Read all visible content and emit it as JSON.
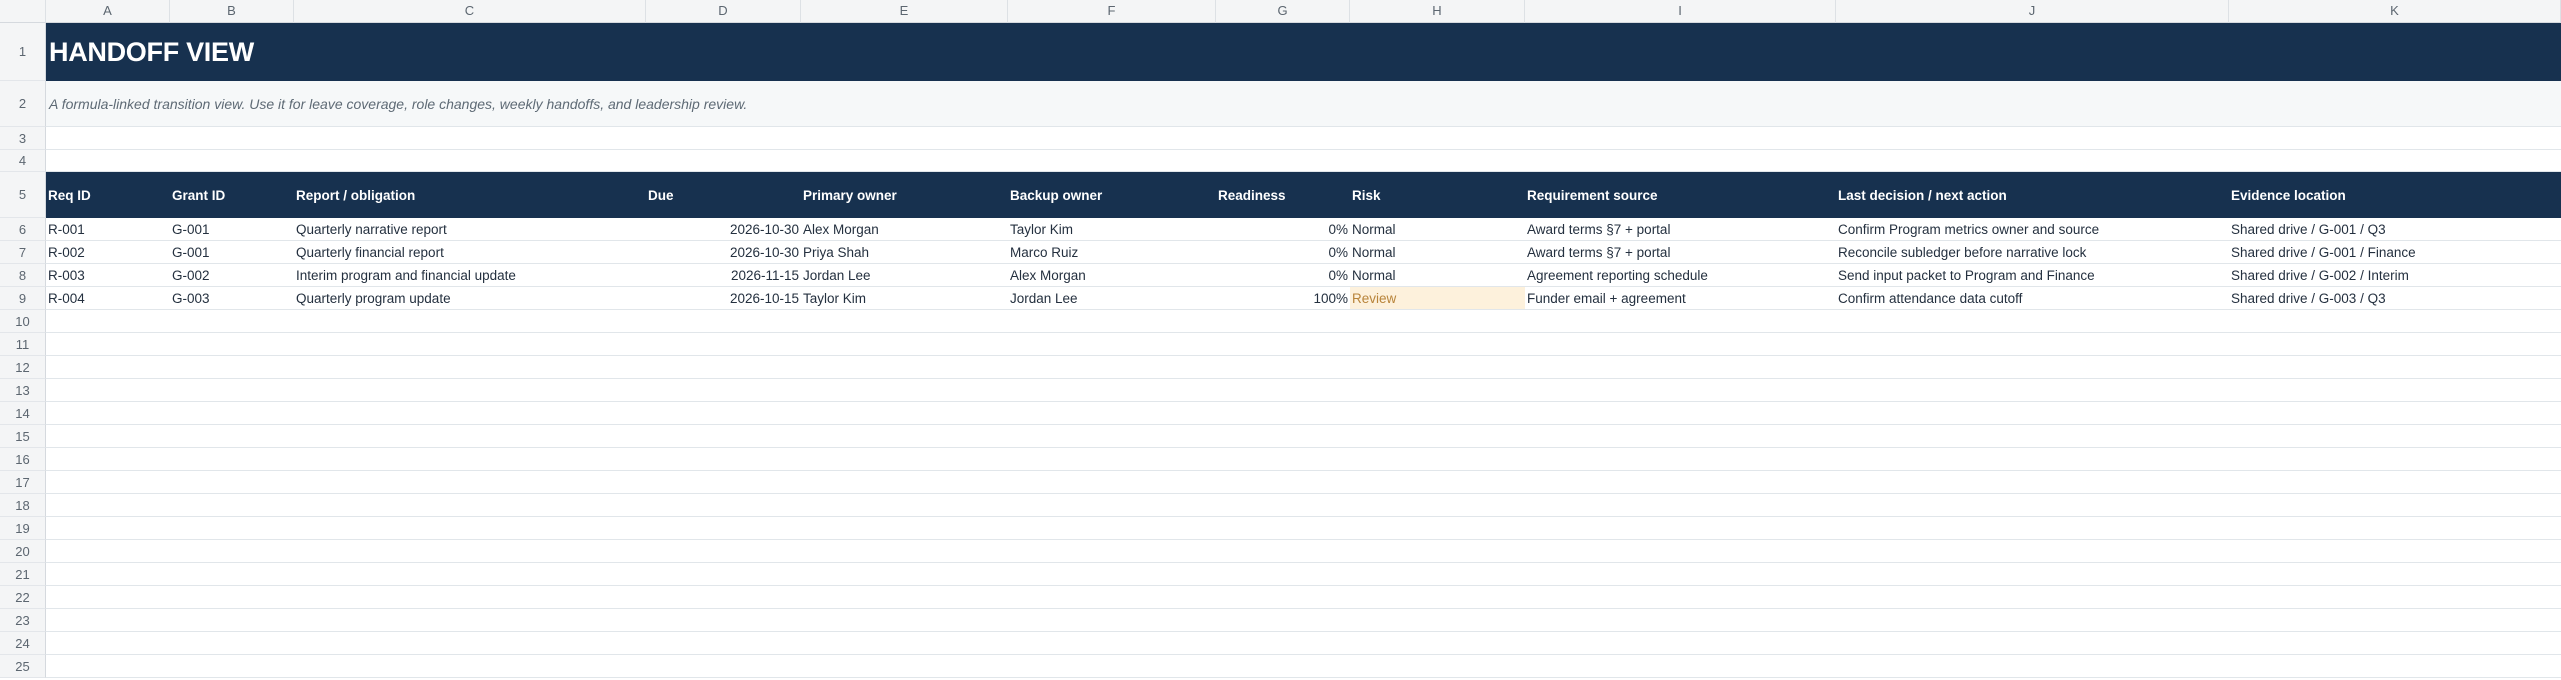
{
  "columns": [
    "A",
    "B",
    "C",
    "D",
    "E",
    "F",
    "G",
    "H",
    "I",
    "J",
    "K"
  ],
  "rows": [
    "1",
    "2",
    "3",
    "4",
    "5",
    "6",
    "7",
    "8",
    "9",
    "10",
    "11",
    "12",
    "13",
    "14",
    "15",
    "16",
    "17",
    "18",
    "19",
    "20",
    "21",
    "22",
    "23",
    "24",
    "25"
  ],
  "title": "HANDOFF VIEW",
  "subtitle": "A formula-linked transition view. Use it for leave coverage, role changes, weekly handoffs, and leadership review.",
  "headers": {
    "req_id": "Req ID",
    "grant_id": "Grant ID",
    "report": "Report / obligation",
    "due": "Due",
    "primary": "Primary owner",
    "backup": "Backup owner",
    "readiness": "Readiness",
    "risk": "Risk",
    "source": "Requirement source",
    "decision": "Last decision / next action",
    "evidence": "Evidence location"
  },
  "records": [
    {
      "req_id": "R-001",
      "grant_id": "G-001",
      "report": "Quarterly narrative report",
      "due": "2026-10-30",
      "primary": "Alex Morgan",
      "backup": "Taylor Kim",
      "readiness": "0%",
      "risk": "Normal",
      "source": "Award terms §7 + portal",
      "decision": "Confirm Program metrics owner and source",
      "evidence": "Shared drive / G-001 / Q3"
    },
    {
      "req_id": "R-002",
      "grant_id": "G-001",
      "report": "Quarterly financial report",
      "due": "2026-10-30",
      "primary": "Priya Shah",
      "backup": "Marco Ruiz",
      "readiness": "0%",
      "risk": "Normal",
      "source": "Award terms §7 + portal",
      "decision": "Reconcile subledger before narrative lock",
      "evidence": "Shared drive / G-001 / Finance"
    },
    {
      "req_id": "R-003",
      "grant_id": "G-002",
      "report": "Interim program and financial update",
      "due": "2026-11-15",
      "primary": "Jordan Lee",
      "backup": "Alex Morgan",
      "readiness": "0%",
      "risk": "Normal",
      "source": "Agreement reporting schedule",
      "decision": "Send input packet to Program and Finance",
      "evidence": "Shared drive / G-002 / Interim"
    },
    {
      "req_id": "R-004",
      "grant_id": "G-003",
      "report": "Quarterly program update",
      "due": "2026-10-15",
      "primary": "Taylor Kim",
      "backup": "Jordan Lee",
      "readiness": "100%",
      "risk": "Review",
      "source": "Funder email + agreement",
      "decision": "Confirm attendance data cutoff",
      "evidence": "Shared drive / G-003 / Q3"
    }
  ]
}
